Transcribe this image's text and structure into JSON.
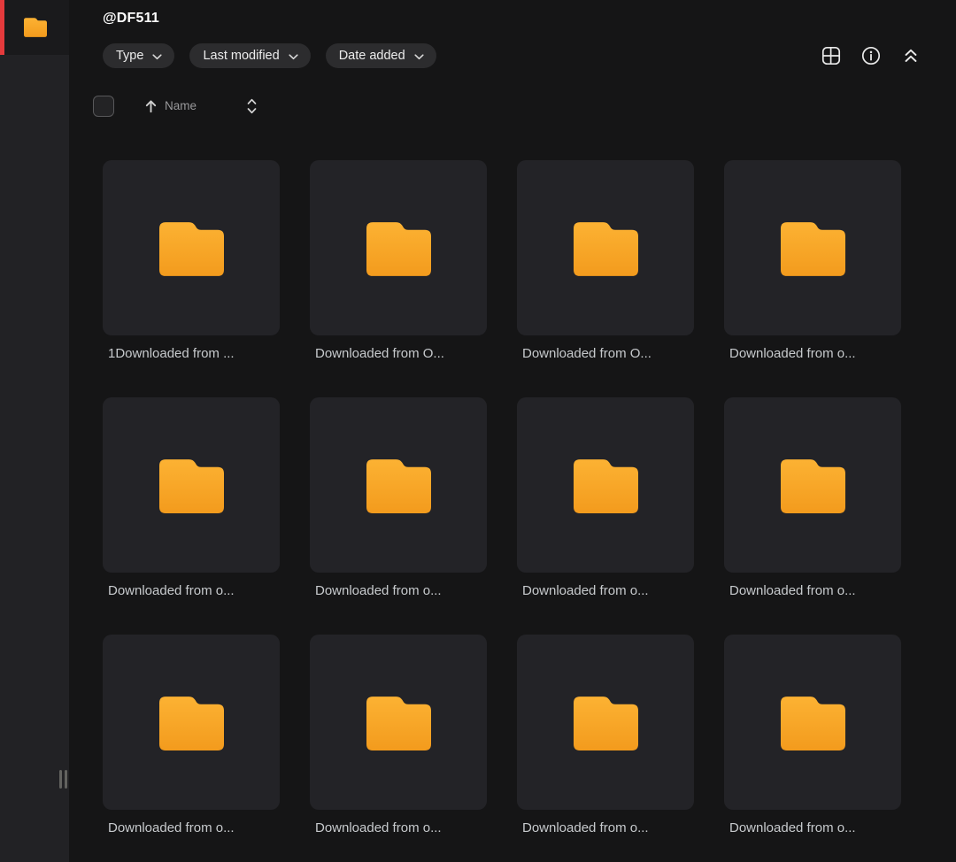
{
  "app": {
    "accent_red": "#e53a3c",
    "folder_color_top": "#fcb233",
    "folder_color_bottom": "#f39b1d",
    "background": "#151516",
    "sidebar_background": "#222225",
    "card_background": "#232327"
  },
  "sidebar": {
    "logo_icon": "folder-icon",
    "resize_handle": "drag-handle"
  },
  "header": {
    "title": "@DF511"
  },
  "filters": [
    {
      "label": "Type",
      "icon": "chevron-down-icon"
    },
    {
      "label": "Last modified",
      "icon": "chevron-down-icon"
    },
    {
      "label": "Date added",
      "icon": "chevron-down-icon"
    }
  ],
  "toolbar": {
    "icons": [
      "grid-view-icon",
      "info-icon",
      "collapse-up-icon"
    ]
  },
  "sort_bar": {
    "checkbox_checked": false,
    "direction_icon": "arrow-up-icon",
    "sort_label": "Name",
    "toggle_icon": "chevron-up-down-icon"
  },
  "folders": [
    {
      "label": "1Downloaded from ..."
    },
    {
      "label": "Downloaded from O..."
    },
    {
      "label": "Downloaded from O..."
    },
    {
      "label": "Downloaded from o..."
    },
    {
      "label": "Downloaded from o..."
    },
    {
      "label": "Downloaded from o..."
    },
    {
      "label": "Downloaded from o..."
    },
    {
      "label": "Downloaded from o..."
    },
    {
      "label": "Downloaded from o..."
    },
    {
      "label": "Downloaded from o..."
    },
    {
      "label": "Downloaded from o..."
    },
    {
      "label": "Downloaded from o..."
    }
  ]
}
